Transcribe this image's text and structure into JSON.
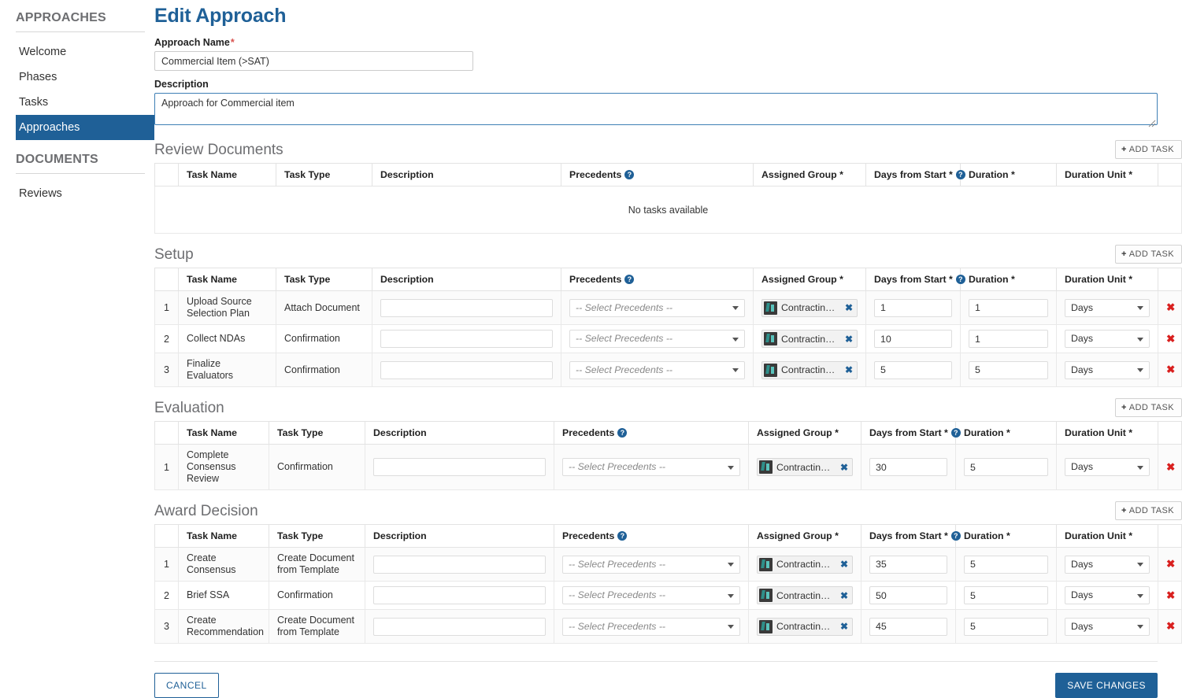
{
  "sidebar": {
    "groups": [
      {
        "title": "APPROACHES",
        "items": [
          {
            "label": "Welcome",
            "active": false
          },
          {
            "label": "Phases",
            "active": false
          },
          {
            "label": "Tasks",
            "active": false
          },
          {
            "label": "Approaches",
            "active": true
          }
        ]
      },
      {
        "title": "DOCUMENTS",
        "items": [
          {
            "label": "Reviews",
            "active": false
          }
        ]
      }
    ]
  },
  "page": {
    "title": "Edit Approach",
    "approach_name_label": "Approach Name",
    "approach_name_value": "Commercial Item (>SAT)",
    "description_label": "Description",
    "description_value": "Approach for Commercial item",
    "required_marker": "*"
  },
  "common": {
    "add_task_label": "ADD TASK",
    "add_task_plus": "+",
    "help_glyph": "?",
    "select_precedents_placeholder": "-- Select Precedents --",
    "assigned_group_value": "Contracting Officer",
    "remove_chip_glyph": "✖",
    "delete_row_glyph": "✖",
    "no_tasks_text": "No tasks available",
    "columns": {
      "index": "",
      "task_name": "Task Name",
      "task_type": "Task Type",
      "description": "Description",
      "precedents": "Precedents",
      "assigned_group": "Assigned Group *",
      "days_from_start": "Days from Start *",
      "duration": "Duration *",
      "duration_unit": "Duration Unit *"
    }
  },
  "sections": [
    {
      "title": "Review Documents",
      "empty": true,
      "rows": []
    },
    {
      "title": "Setup",
      "empty": false,
      "rows": [
        {
          "index": "1",
          "task_name": "Upload Source Selection Plan",
          "task_type": "Attach Document",
          "description": "",
          "precedents": "-- Select Precedents --",
          "assigned_group": "Contracting Officer",
          "days_from_start": "1",
          "duration": "1",
          "duration_unit": "Days"
        },
        {
          "index": "2",
          "task_name": "Collect NDAs",
          "task_type": "Confirmation",
          "description": "",
          "precedents": "-- Select Precedents --",
          "assigned_group": "Contracting Officer",
          "days_from_start": "10",
          "duration": "1",
          "duration_unit": "Days"
        },
        {
          "index": "3",
          "task_name": "Finalize Evaluators",
          "task_type": "Confirmation",
          "description": "",
          "precedents": "-- Select Precedents --",
          "assigned_group": "Contracting Officer",
          "days_from_start": "5",
          "duration": "5",
          "duration_unit": "Days"
        }
      ]
    },
    {
      "title": "Evaluation",
      "empty": false,
      "rows": [
        {
          "index": "1",
          "task_name": "Complete Consensus Review",
          "task_type": "Confirmation",
          "description": "",
          "precedents": "-- Select Precedents --",
          "assigned_group": "Contracting Officer",
          "days_from_start": "30",
          "duration": "5",
          "duration_unit": "Days"
        }
      ]
    },
    {
      "title": "Award Decision",
      "empty": false,
      "rows": [
        {
          "index": "1",
          "task_name": "Create Consensus",
          "task_type": "Create Document from Template",
          "description": "",
          "precedents": "-- Select Precedents --",
          "assigned_group": "Contracting Officer",
          "days_from_start": "35",
          "duration": "5",
          "duration_unit": "Days"
        },
        {
          "index": "2",
          "task_name": "Brief SSA",
          "task_type": "Confirmation",
          "description": "",
          "precedents": "-- Select Precedents --",
          "assigned_group": "Contracting Officer",
          "days_from_start": "50",
          "duration": "5",
          "duration_unit": "Days"
        },
        {
          "index": "3",
          "task_name": "Create Recommendation",
          "task_type": "Create Document from Template",
          "description": "",
          "precedents": "-- Select Precedents --",
          "assigned_group": "Contracting Officer",
          "days_from_start": "45",
          "duration": "5",
          "duration_unit": "Days"
        }
      ]
    }
  ],
  "footer": {
    "cancel_label": "CANCEL",
    "save_label": "SAVE CHANGES"
  },
  "colors": {
    "accent": "#1f6097",
    "required": "#d9534f",
    "delete": "#d9201f",
    "section_title": "#6d6e71"
  }
}
